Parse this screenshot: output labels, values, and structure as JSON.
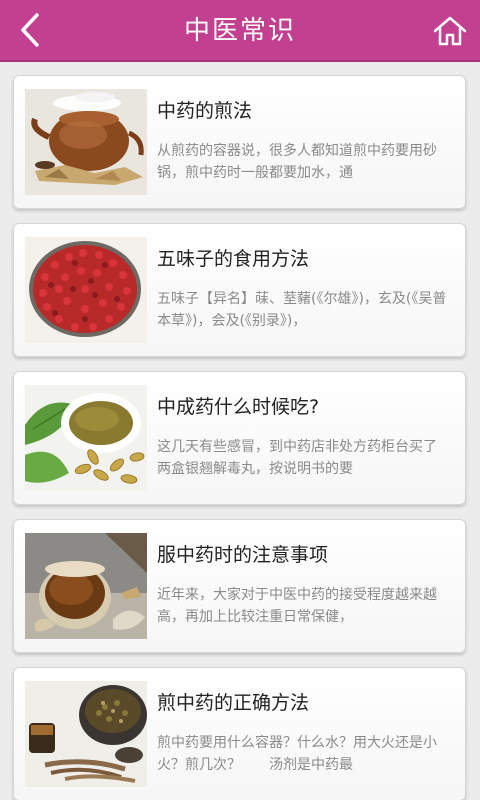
{
  "header": {
    "title": "中医常识",
    "back_icon": "chevron-left-icon",
    "home_icon": "home-icon",
    "color": "#c2408f"
  },
  "articles": [
    {
      "title": "中药的煎法",
      "desc": "从煎药的容器说，很多人都知道煎中药要用砂锅，煎中药时一般都要加水，通",
      "image": "clay-teapot-with-herbs"
    },
    {
      "title": "五味子的食用方法",
      "desc": "五味子【异名】菋、荎藸(《尔雄》)，玄及(《吴普本草》)，会及(《别录》)，",
      "image": "red-schisandra-berries"
    },
    {
      "title": "中成药什么时候吃?",
      "desc": "这几天有些感冒，到中药店非处方药柜台买了两盒银翘解毒丸，按说明书的要",
      "image": "herbal-powder-and-capsules"
    },
    {
      "title": "服中药时的注意事项",
      "desc": "近年来，大家对于中医中药的接受程度越来越高，再加上比较注重日常保健，",
      "image": "herbal-tea-cup"
    },
    {
      "title": "煎中药的正确方法",
      "desc": "煎中药要用什么容器？什么水？用大火还是小火？煎几次？　　汤剂是中药最",
      "image": "decoction-pot-and-roots"
    }
  ]
}
